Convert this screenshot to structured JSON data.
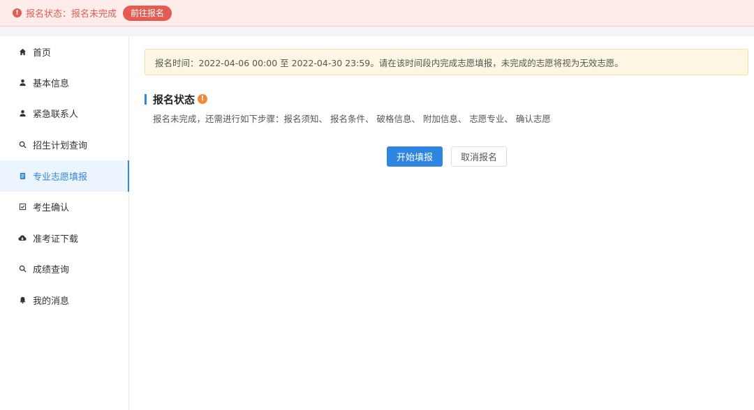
{
  "alert": {
    "icon": "exclamation-circle-icon",
    "text": "报名状态：报名未完成",
    "button": "前往报名",
    "color": "#e25c53"
  },
  "sidebar": {
    "accent": "#2f86e0",
    "active_index": 4,
    "items": [
      {
        "label": "首页",
        "icon": "home-icon"
      },
      {
        "label": "基本信息",
        "icon": "user-icon"
      },
      {
        "label": "紧急联系人",
        "icon": "user-icon"
      },
      {
        "label": "招生计划查询",
        "icon": "search-icon"
      },
      {
        "label": "专业志愿填报",
        "icon": "document-icon"
      },
      {
        "label": "考生确认",
        "icon": "checkbox-icon"
      },
      {
        "label": "准考证下载",
        "icon": "cloud-download-icon"
      },
      {
        "label": "成绩查询",
        "icon": "search-icon"
      },
      {
        "label": "我的消息",
        "icon": "bell-icon"
      }
    ]
  },
  "notice": {
    "text": "报名时间：2022-04-06 00:00 至 2022-04-30 23:59。请在该时间段内完成志愿填报，未完成的志愿将视为无效志愿。"
  },
  "status": {
    "title": "报名状态",
    "warning_icon": "exclamation-circle-icon",
    "steps_text": "报名未完成，还需进行如下步骤：报名须知、 报名条件、 破格信息、 附加信息、 志愿专业、 确认志愿"
  },
  "actions": {
    "start_label": "开始填报",
    "cancel_label": "取消报名"
  }
}
